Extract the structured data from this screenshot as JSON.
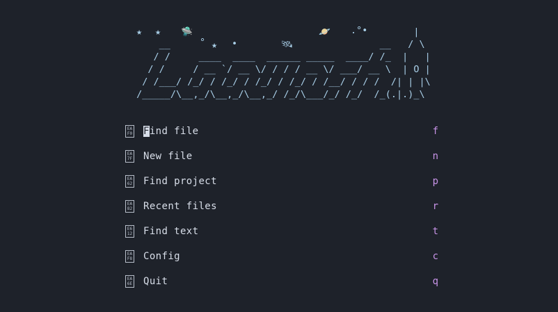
{
  "banner": {
    "lines": [
      "                                                  |",
      "     __                                     __   / \\",
      "    / /     ____  ____  ______ _____  ____/ /_  |   |",
      "   / /     / __ `/ __ \\/ / / / __ \\/ ___/ __ \\  | O |",
      "  / /___/ /_/ / /_/ / /_/ / /_/ / /__/ / / /  /| | |\\",
      " /_____/\\__,_/\\__,_/\\__,_/ /_/\\___/_/ /_/  /_(.|.)_\\"
    ],
    "decorations": [
      "★",
      "★",
      "🛸",
      "°",
      "★",
      "•",
      "🛰",
      "🪐",
      ".°•"
    ]
  },
  "menu": {
    "items": [
      {
        "icon_name": "search-file-icon",
        "icon_code_top": "EA",
        "icon_code_bottom": "F0",
        "label_first": "F",
        "label_rest": "ind file",
        "key": "f"
      },
      {
        "icon_name": "new-file-icon",
        "icon_code_top": "EA",
        "icon_code_bottom": "7F",
        "label": "New file",
        "key": "n"
      },
      {
        "icon_name": "project-icon",
        "icon_code_top": "EA",
        "icon_code_bottom": "62",
        "label": "Find project",
        "key": "p"
      },
      {
        "icon_name": "history-icon",
        "icon_code_top": "EA",
        "icon_code_bottom": "82",
        "label": "Recent files",
        "key": "r"
      },
      {
        "icon_name": "text-search-icon",
        "icon_code_top": "E6",
        "icon_code_bottom": "12",
        "label": "Find text",
        "key": "t"
      },
      {
        "icon_name": "gear-icon",
        "icon_code_top": "EA",
        "icon_code_bottom": "F8",
        "label": "Config",
        "key": "c"
      },
      {
        "icon_name": "quit-icon",
        "icon_code_top": "EA",
        "icon_code_bottom": "6E",
        "label": "Quit",
        "key": "q"
      }
    ]
  },
  "colors": {
    "background": "#1e222a",
    "banner": "#a9cfe8",
    "text": "#d8dee9",
    "shortcut": "#c793e6"
  }
}
